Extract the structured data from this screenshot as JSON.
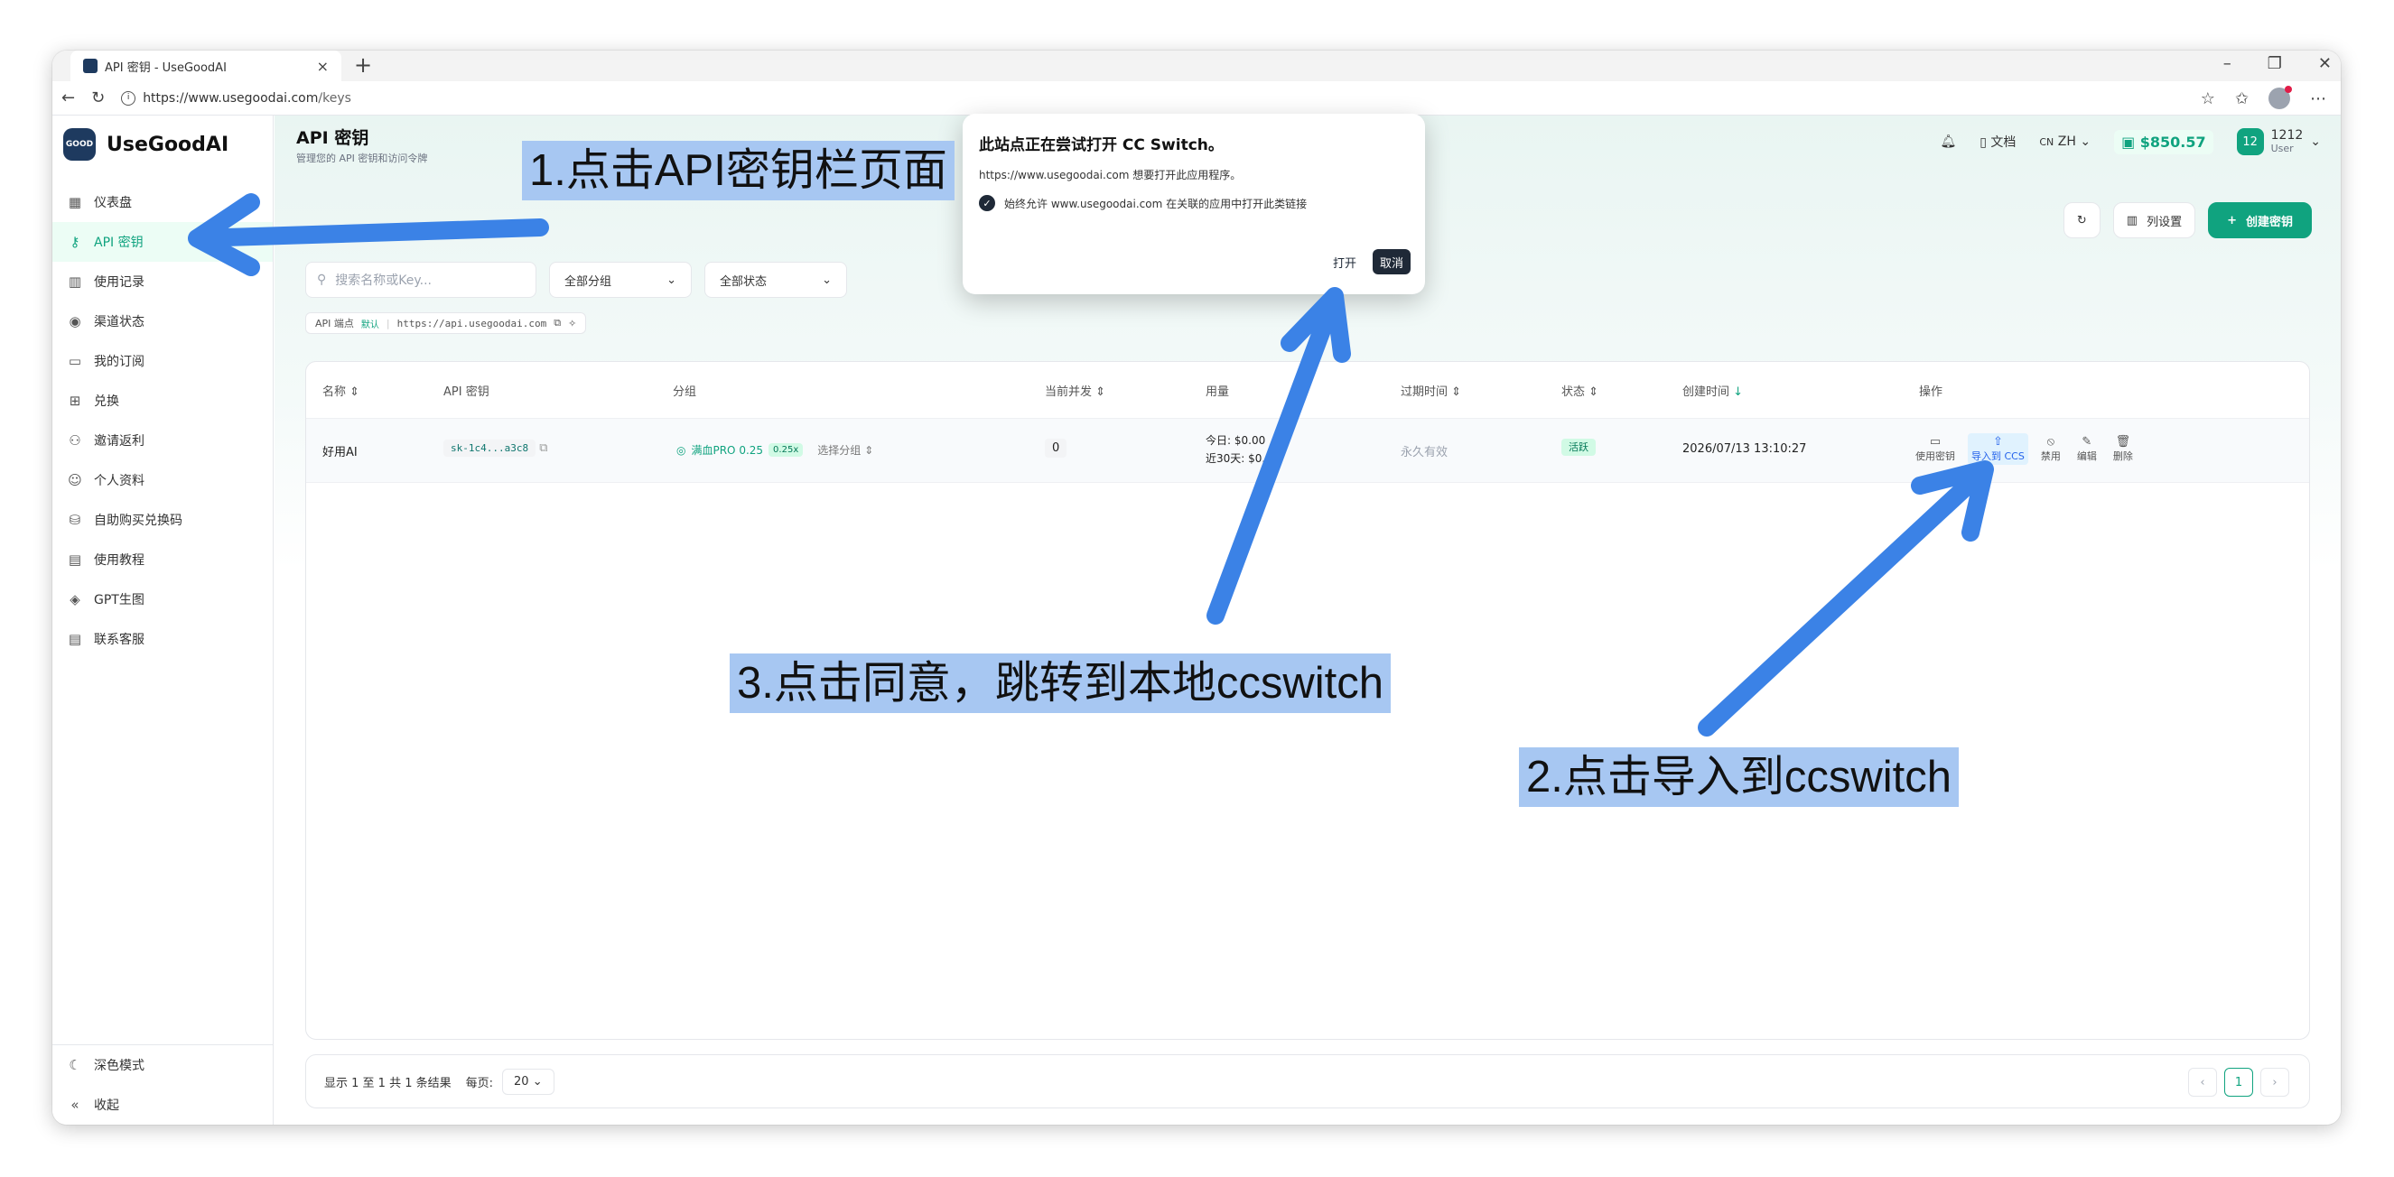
{
  "browser": {
    "tab_title": "API 密钥 - UseGoodAI",
    "url_main": "https://www.usegoodai.com",
    "url_path": "/keys"
  },
  "sidebar": {
    "logo_text": "GOOD",
    "brand": "UseGoodAI",
    "items": [
      {
        "label": "仪表盘",
        "icon": "dashboard-icon"
      },
      {
        "label": "API 密钥",
        "icon": "key-icon"
      },
      {
        "label": "使用记录",
        "icon": "bar-chart-icon"
      },
      {
        "label": "渠道状态",
        "icon": "signal-icon"
      },
      {
        "label": "我的订阅",
        "icon": "card-icon"
      },
      {
        "label": "兑换",
        "icon": "gift-icon"
      },
      {
        "label": "邀请返利",
        "icon": "users-icon"
      },
      {
        "label": "个人资料",
        "icon": "user-icon"
      },
      {
        "label": "自助购买兑换码",
        "icon": "cart-icon"
      },
      {
        "label": "使用教程",
        "icon": "book-icon"
      },
      {
        "label": "GPT生图",
        "icon": "image-icon"
      },
      {
        "label": "联系客服",
        "icon": "support-icon"
      }
    ],
    "dark_mode": "深色模式",
    "collapse": "收起"
  },
  "header": {
    "title": "API 密钥",
    "subtitle": "管理您的 API 密钥和访问令牌",
    "docs": "文档",
    "lang": "ZH",
    "lang_prefix": "CN",
    "balance": "$850.57",
    "user_initials": "12",
    "user_name": "1212",
    "user_role": "User"
  },
  "toolbar": {
    "columns": "列设置",
    "create": "创建密钥"
  },
  "filters": {
    "search_placeholder": "搜索名称或Key...",
    "group": "全部分组",
    "status": "全部状态"
  },
  "endpoint": {
    "label": "API 端点",
    "tag": "默认",
    "url": "https://api.usegoodai.com"
  },
  "table": {
    "headers": [
      "名称",
      "API 密钥",
      "分组",
      "当前并发",
      "用量",
      "过期时间",
      "状态",
      "创建时间",
      "操作"
    ],
    "row": {
      "name": "好用AI",
      "key": "sk-1c4...a3c8",
      "group": "满血PRO 0.25",
      "ratio": "0.25x",
      "select_group": "选择分组",
      "concurrency": "0",
      "usage_today": "今日: $0.00",
      "usage_30d": "近30天: $0.47",
      "expiry": "永久有效",
      "status": "活跃",
      "created": "2026/07/13 13:10:27",
      "ops": [
        "使用密钥",
        "导入到 CCS",
        "禁用",
        "编辑",
        "删除"
      ]
    }
  },
  "pagination": {
    "summary": "显示 1 至 1 共 1 条结果",
    "per_page_label": "每页:",
    "per_page": "20",
    "current_page": "1"
  },
  "popup": {
    "title": "此站点正在尝试打开 CC Switch。",
    "message": "https://www.usegoodai.com 想要打开此应用程序。",
    "checkbox": "始终允许 www.usegoodai.com 在关联的应用中打开此类链接",
    "open": "打开",
    "cancel": "取消"
  },
  "annotations": {
    "step1": "1.点击API密钥栏页面",
    "step2": "2.点击导入到ccswitch",
    "step3": "3.点击同意，跳转到本地ccswitch",
    "arrow_color": "#3b82e6"
  }
}
